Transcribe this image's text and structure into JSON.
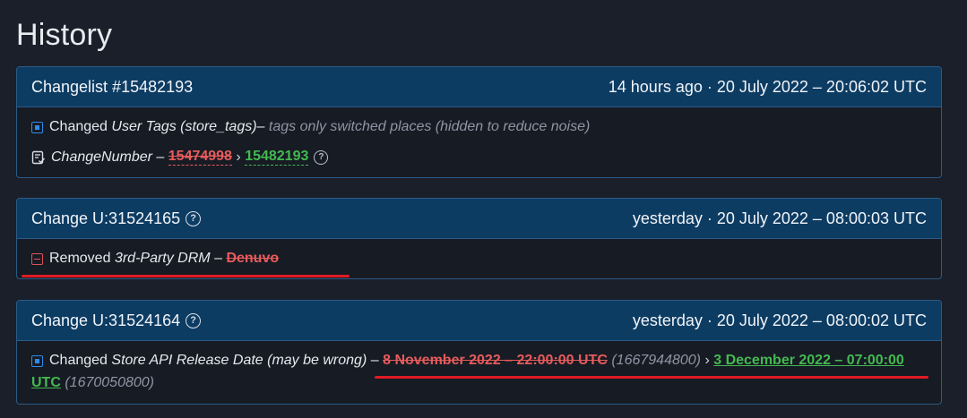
{
  "page": {
    "title": "History"
  },
  "entries": [
    {
      "title": "Changelist #15482193",
      "time": "14 hours ago · 20 July 2022 – 20:06:02 UTC",
      "rows": [
        {
          "prefix": "Changed",
          "field": "User Tags (store_tags)",
          "dash": "–",
          "note": "tags only switched places (hidden to reduce noise)"
        },
        {
          "field": "ChangeNumber",
          "dash": "–",
          "old": "15474998",
          "arrow": "›",
          "new": "15482193"
        }
      ]
    },
    {
      "title": "Change U:31524165",
      "time": "yesterday · 20 July 2022 – 08:00:03 UTC",
      "rows": [
        {
          "prefix": "Removed",
          "field": "3rd-Party DRM",
          "dash": "–",
          "old": "Denuvo"
        }
      ]
    },
    {
      "title": "Change U:31524164",
      "time": "yesterday · 20 July 2022 – 08:00:02 UTC",
      "rows": [
        {
          "prefix": "Changed",
          "field": "Store API Release Date (may be wrong)",
          "dash": "–",
          "old": "8 November 2022 – 22:00:00 UTC",
          "old_raw": "(1667944800)",
          "arrow": "›",
          "new_line1": "3 December 2022 – 07:00:00",
          "new_line2": "UTC",
          "new_raw": "(1670050800)"
        }
      ]
    }
  ],
  "colors": {
    "background": "#1b1f29",
    "header": "#0d3c63",
    "border": "#2b5b86",
    "removed": "#e65b5b",
    "added": "#43b94f",
    "highlight": "#e01b24"
  }
}
